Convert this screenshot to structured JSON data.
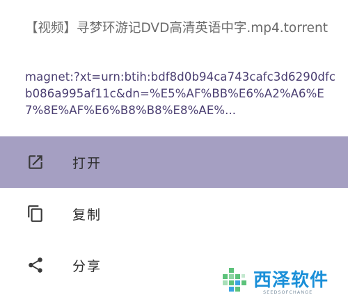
{
  "header": {
    "file_title": "【视频】寻梦环游记DVD高清英语中字.mp4.torrent",
    "magnet_text": "magnet:?xt=urn:btih:bdf8d0b94ca743cafc3d6290dfcb086a995af11c&dn=%E5%AF%BB%E6%A2%A6%E7%8E%AF%E6%B8%B8%E8%AE%..."
  },
  "menu": {
    "items": [
      {
        "label": "打开",
        "icon": "open-external-icon",
        "selected": true
      },
      {
        "label": "复制",
        "icon": "copy-icon",
        "selected": false
      },
      {
        "label": "分享",
        "icon": "share-icon",
        "selected": false
      }
    ]
  },
  "watermark": {
    "brand": "西泽软件",
    "tagline": "SEEDSOFCHANGE"
  },
  "colors": {
    "selected_bg": "#a59fc2",
    "magnet_text": "#4b3f72",
    "title_text": "#6b6b6b",
    "watermark_blue": "#1a8fd8",
    "watermark_green": "#5cc27a"
  }
}
